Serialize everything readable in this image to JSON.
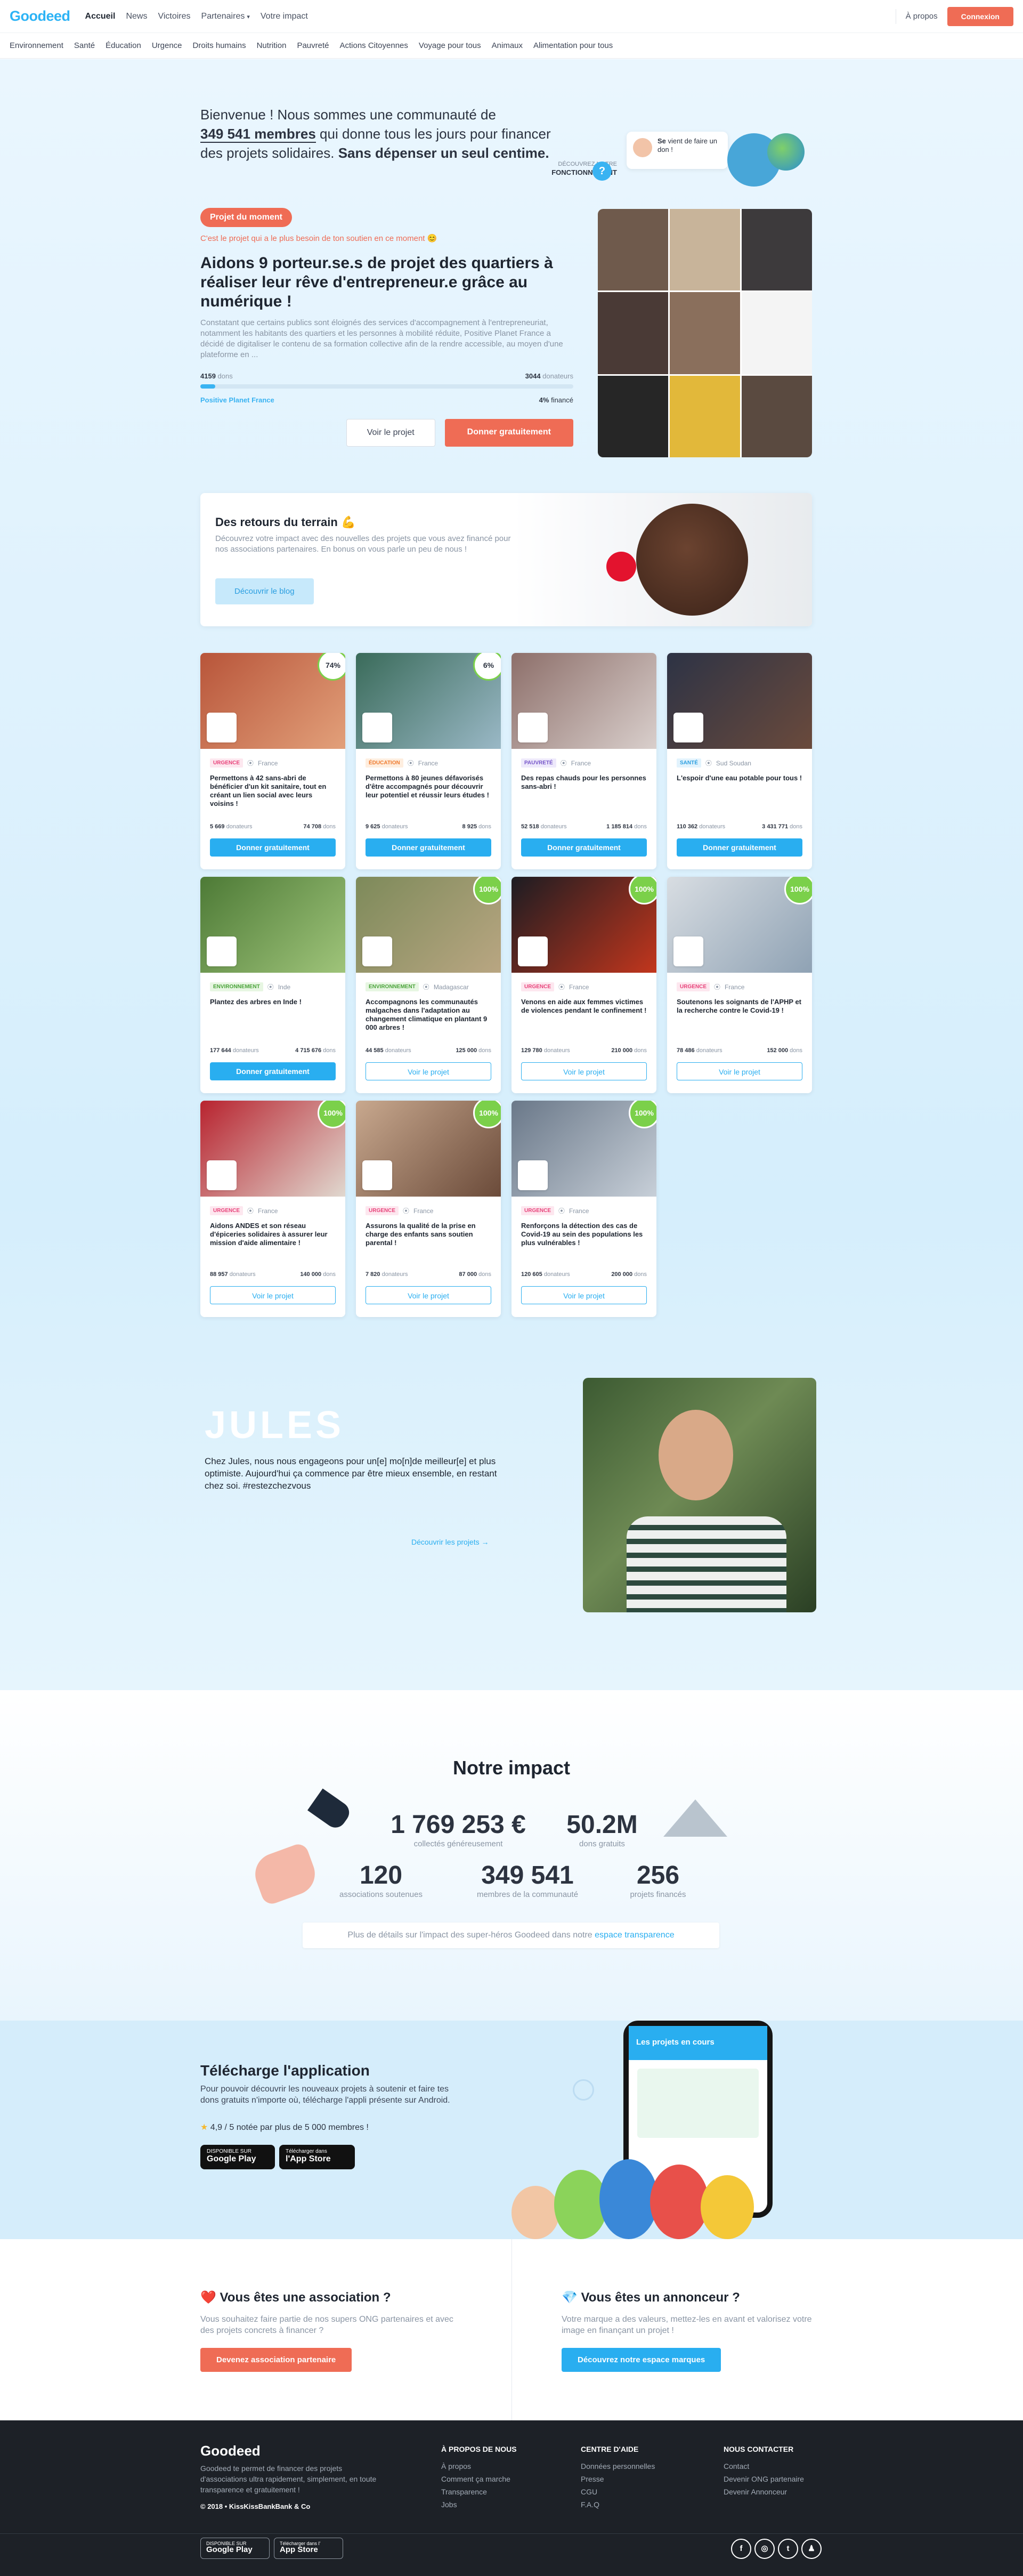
{
  "header": {
    "logo": "Goodeed",
    "nav": [
      "Accueil",
      "News",
      "Victoires",
      "Partenaires",
      "Votre impact"
    ],
    "apropos": "À propos",
    "connexion": "Connexion"
  },
  "categories": [
    "Environnement",
    "Santé",
    "Éducation",
    "Urgence",
    "Droits humains",
    "Nutrition",
    "Pauvreté",
    "Actions Citoyennes",
    "Voyage pour tous",
    "Animaux",
    "Alimentation pour tous"
  ],
  "intro": {
    "line1": "Bienvenue ! Nous sommes une communauté de",
    "members": "349 541 membres",
    "line2": " qui donne tous les jours pour financer des projets solidaires. ",
    "bold": "Sans dépenser un seul centime.",
    "bubble_name": "Se",
    "bubble_text": "vient de faire un don !",
    "fonct_label": "DÉCOUVREZ NOTRE",
    "fonct_bold": "FONCTIONNEMENT",
    "q": "?"
  },
  "featured": {
    "pill": "Projet du moment",
    "sub": "C'est le projet qui a le plus besoin de ton soutien en ce moment 😊",
    "title": "Aidons 9 porteur.se.s de projet des quartiers à réaliser leur rêve d'entrepreneur.e grâce au numérique !",
    "desc": "Constatant que certains publics sont éloignés des services d'accompagnement à l'entrepreneuriat, notamment les habitants des quartiers et les personnes à mobilité réduite, Positive Planet France a décidé de digitaliser le contenu de sa formation collective afin de la rendre accessible, au moyen d'une plateforme en ...",
    "dons": "4159",
    "dons_label": "dons",
    "donateurs": "3044",
    "donateurs_label": "donateurs",
    "progress_pct": 4,
    "org": "Positive Planet France",
    "finance": "4%",
    "finance_label": "financé",
    "see": "Voir le projet",
    "give": "Donner gratuitement"
  },
  "blog": {
    "title": "Des retours du terrain 💪",
    "text": "Découvrez votre impact avec des nouvelles des projets que vous avez financé pour nos associations partenaires. En bonus on vous parle un peu de nous !",
    "button": "Découvrir le blog"
  },
  "cards": [
    {
      "tag": "URGENCE",
      "tagc": "#e8437a",
      "tagbg": "#fde7ef",
      "loc": "France",
      "title": "Permettons à 42 sans-abri de bénéficier d'un kit sanitaire, tout en créant un lien social avec leurs voisins !",
      "left": "5 669",
      "left_l": "donateurs",
      "right": "74 708",
      "right_l": "dons",
      "badge": "74%",
      "full": false,
      "btn": "Donner gratuitement",
      "give": true,
      "c1": "#b8553a",
      "c2": "#e2a07a"
    },
    {
      "tag": "ÉDUCATION",
      "tagc": "#ef7a2e",
      "tagbg": "#feeedf",
      "loc": "France",
      "title": "Permettons à 80 jeunes défavorisés d'être accompagnés pour découvrir leur potentiel et réussir leurs études !",
      "left": "9 625",
      "left_l": "donateurs",
      "right": "8 925",
      "right_l": "dons",
      "badge": "6%",
      "full": false,
      "btn": "Donner gratuitement",
      "give": true,
      "c1": "#3a6b5a",
      "c2": "#9ab8c6"
    },
    {
      "tag": "PAUVRETÉ",
      "tagc": "#7656c9",
      "tagbg": "#eee9fb",
      "loc": "France",
      "title": "Des repas chauds pour les personnes sans-abri !",
      "left": "52 518",
      "left_l": "donateurs",
      "right": "1 185 814",
      "right_l": "dons",
      "badge": "",
      "full": false,
      "btn": "Donner gratuitement",
      "give": true,
      "c1": "#8d6f6a",
      "c2": "#d9cfcc"
    },
    {
      "tag": "SANTÉ",
      "tagc": "#2a9ee0",
      "tagbg": "#e2f3fd",
      "loc": "Sud Soudan",
      "title": "L'espoir d'une eau potable pour tous !",
      "left": "110 362",
      "left_l": "donateurs",
      "right": "3 431 771",
      "right_l": "dons",
      "badge": "",
      "full": false,
      "btn": "Donner gratuitement",
      "give": true,
      "c1": "#2d3345",
      "c2": "#6a4a3c"
    },
    {
      "tag": "ENVIRONNEMENT",
      "tagc": "#4aa33a",
      "tagbg": "#e7f6e2",
      "loc": "Inde",
      "title": "Plantez des arbres en Inde !",
      "left": "177 644",
      "left_l": "donateurs",
      "right": "4 715 676",
      "right_l": "dons",
      "badge": "",
      "full": false,
      "btn": "Donner gratuitement",
      "give": true,
      "c1": "#4d7a36",
      "c2": "#9fc47a"
    },
    {
      "tag": "ENVIRONNEMENT",
      "tagc": "#4aa33a",
      "tagbg": "#e7f6e2",
      "loc": "Madagascar",
      "title": "Accompagnons les communautés malgaches dans l'adaptation au changement climatique en plantant 9 000 arbres !",
      "left": "44 585",
      "left_l": "donateurs",
      "right": "125 000",
      "right_l": "dons",
      "badge": "100%",
      "full": true,
      "btn": "Voir le projet",
      "give": false,
      "c1": "#7d8a5a",
      "c2": "#b9a682"
    },
    {
      "tag": "URGENCE",
      "tagc": "#e8437a",
      "tagbg": "#fde7ef",
      "loc": "France",
      "title": "Venons en aide aux femmes victimes de violences pendant le confinement !",
      "left": "129 780",
      "left_l": "donateurs",
      "right": "210 000",
      "right_l": "dons",
      "badge": "100%",
      "full": true,
      "btn": "Voir le projet",
      "give": false,
      "c1": "#1c1c22",
      "c2": "#c2361d"
    },
    {
      "tag": "URGENCE",
      "tagc": "#e8437a",
      "tagbg": "#fde7ef",
      "loc": "France",
      "title": "Soutenons les soignants de l'APHP et la recherche contre le Covid-19 !",
      "left": "78 486",
      "left_l": "donateurs",
      "right": "152 000",
      "right_l": "dons",
      "badge": "100%",
      "full": true,
      "btn": "Voir le projet",
      "give": false,
      "c1": "#d8dde2",
      "c2": "#8fa2b4"
    },
    {
      "tag": "URGENCE",
      "tagc": "#e8437a",
      "tagbg": "#fde7ef",
      "loc": "France",
      "title": "Aidons ANDES et son réseau d'épiceries solidaires à assurer leur mission d'aide alimentaire !",
      "left": "88 957",
      "left_l": "donateurs",
      "right": "140 000",
      "right_l": "dons",
      "badge": "100%",
      "full": true,
      "btn": "Voir le projet",
      "give": false,
      "c1": "#b8232f",
      "c2": "#e0d8cf"
    },
    {
      "tag": "URGENCE",
      "tagc": "#e8437a",
      "tagbg": "#fde7ef",
      "loc": "France",
      "title": "Assurons la qualité de la prise en charge des enfants sans soutien parental !",
      "left": "7 820",
      "left_l": "donateurs",
      "right": "87 000",
      "right_l": "dons",
      "badge": "100%",
      "full": true,
      "btn": "Voir le projet",
      "give": false,
      "c1": "#c8a88e",
      "c2": "#6b4b3a"
    },
    {
      "tag": "URGENCE",
      "tagc": "#e8437a",
      "tagbg": "#fde7ef",
      "loc": "France",
      "title": "Renforçons la détection des cas de Covid-19 au sein des populations les plus vulnérables !",
      "left": "120 605",
      "left_l": "donateurs",
      "right": "200 000",
      "right_l": "dons",
      "badge": "100%",
      "full": true,
      "btn": "Voir le projet",
      "give": false,
      "c1": "#6a7889",
      "c2": "#c7cfd8"
    }
  ],
  "jules": {
    "title": "JULES",
    "text": "Chez Jules, nous nous engageons pour un[e] mo[n]de meilleur[e] et plus optimiste. Aujourd'hui ça commence par être mieux ensemble, en restant chez soi. #restezchezvous",
    "link": "Découvrir les projets →"
  },
  "impact": {
    "title": "Notre impact",
    "stats": [
      {
        "v": "1 769 253 €",
        "l": "collectés généreusement"
      },
      {
        "v": "50.2M",
        "l": "dons gratuits"
      },
      {
        "v": "120",
        "l": "associations soutenues"
      },
      {
        "v": "349 541",
        "l": "membres de la communauté"
      },
      {
        "v": "256",
        "l": "projets financés"
      }
    ],
    "more1": "Plus de détails sur l'impact des super-héros Goodeed dans notre ",
    "more2": "espace transparence"
  },
  "app": {
    "title": "Télécharge l'application",
    "text": "Pour pouvoir découvrir les nouveaux projets à soutenir et faire tes dons gratuits n'importe où, télécharge l'appli présente sur Android.",
    "rating": "4,9 / 5 notée par plus de 5 000 membres !",
    "gp_small": "DISPONIBLE SUR",
    "gp": "Google Play",
    "as_small": "Télécharger dans",
    "as": "l'App Store",
    "phone_title": "Les projets en cours"
  },
  "partners": {
    "assoc_title": "❤️ Vous êtes une association ?",
    "assoc_text": "Vous souhaitez faire partie de nos supers ONG partenaires et avec des projets concrets à financer ?",
    "assoc_btn": "Devenez association partenaire",
    "annon_title": "💎 Vous êtes un annonceur ?",
    "annon_text": "Votre marque a des valeurs, mettez-les en avant et valorisez votre image en finançant un projet !",
    "annon_btn": "Découvrez notre espace marques"
  },
  "footer": {
    "logo": "Goodeed",
    "desc": "Goodeed te permet de financer des projets d'associations ultra rapidement, simplement, en toute transparence et gratuitement !",
    "copy": "© 2018 • KissKissBankBank & Co",
    "cols": [
      {
        "h": "À PROPOS DE NOUS",
        "items": [
          "À propos",
          "Comment ça marche",
          "Transparence",
          "Jobs"
        ]
      },
      {
        "h": "CENTRE D'AIDE",
        "items": [
          "Données personnelles",
          "Presse",
          "CGU",
          "F.A.Q"
        ]
      },
      {
        "h": "NOUS CONTACTER",
        "items": [
          "Contact",
          "Devenir ONG partenaire",
          "Devenir Annonceur"
        ]
      }
    ],
    "gp": "Google Play",
    "gp_small": "DISPONIBLE SUR",
    "as": "App Store",
    "as_small": "Télécharger dans l'",
    "social": [
      "f",
      "◎",
      "t",
      "♟"
    ]
  }
}
